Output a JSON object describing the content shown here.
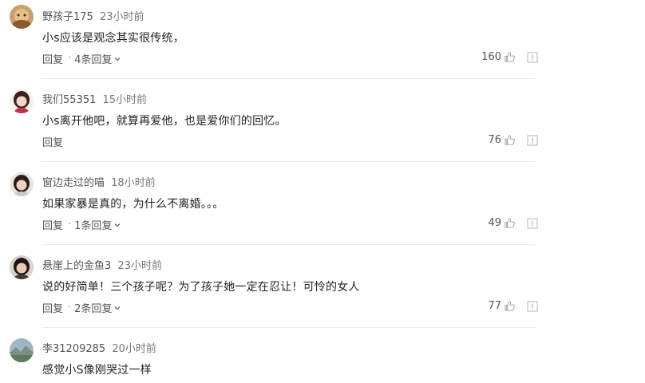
{
  "comments": [
    {
      "username": "野孩子175",
      "time": "23小时前",
      "text": "小s应该是观念其实很传统，",
      "reply_label": "回复",
      "replies_label": "4条回复",
      "likes": "160"
    },
    {
      "username": "我们55351",
      "time": "15小时前",
      "text": "小s离开他吧，就算再爱他，也是爱你们的回忆。",
      "reply_label": "回复",
      "replies_label": "",
      "likes": "76"
    },
    {
      "username": "窗边走过的喵",
      "time": "18小时前",
      "text": "如果家暴是真的，为什么不离婚。。。",
      "reply_label": "回复",
      "replies_label": "1条回复",
      "likes": "49"
    },
    {
      "username": "悬崖上的金鱼3",
      "time": "23小时前",
      "text": "说的好简单！三个孩子呢？为了孩子她一定在忍让！可怜的女人",
      "reply_label": "回复",
      "replies_label": "2条回复",
      "likes": "77"
    },
    {
      "username": "李31209285",
      "time": "20小时前",
      "text": "感觉小S像刚哭过一样",
      "reply_label": "",
      "replies_label": "",
      "likes": ""
    }
  ],
  "icons": {
    "like": "thumbs-up-icon",
    "report": "report-icon",
    "expand": "chevron-down-icon"
  },
  "colors": {
    "text": "#222222",
    "meta": "#666666",
    "divider": "#ececec"
  }
}
